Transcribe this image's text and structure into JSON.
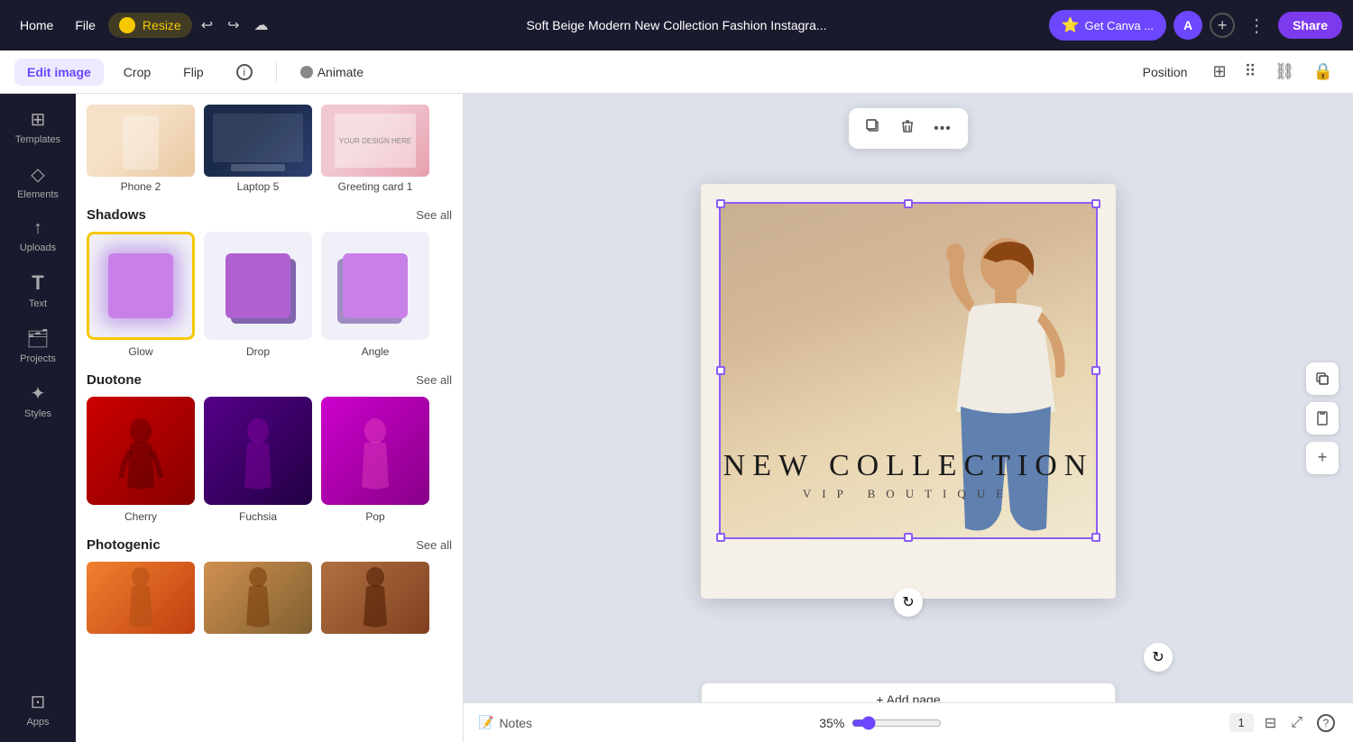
{
  "topbar": {
    "home_label": "Home",
    "file_label": "File",
    "resize_label": "Resize",
    "title": "Soft Beige Modern New Collection Fashion Instagra...",
    "get_canva_label": "Get Canva ...",
    "share_label": "Share",
    "avatar_letter": "A",
    "undo_icon": "↩",
    "redo_icon": "↪",
    "cloud_icon": "☁"
  },
  "secondbar": {
    "edit_image_label": "Edit image",
    "crop_label": "Crop",
    "flip_label": "Flip",
    "info_icon": "ⓘ",
    "animate_icon": "●",
    "animate_label": "Animate",
    "position_label": "Position",
    "grid_icon": "⊞",
    "dots_icon": "⋯",
    "link_icon": "⛓",
    "lock_icon": "🔒"
  },
  "sidebar": {
    "items": [
      {
        "label": "Templates",
        "icon": "⊞"
      },
      {
        "label": "Elements",
        "icon": "◇"
      },
      {
        "label": "Uploads",
        "icon": "↑"
      },
      {
        "label": "Text",
        "icon": "T"
      },
      {
        "label": "Projects",
        "icon": "🗂"
      },
      {
        "label": "Styles",
        "icon": "✦"
      },
      {
        "label": "Apps",
        "icon": "⊡"
      }
    ]
  },
  "left_panel": {
    "thumbnails": [
      {
        "label": "Phone 2"
      },
      {
        "label": "Laptop 5"
      },
      {
        "label": "Greeting card 1"
      }
    ],
    "shadows": {
      "title": "Shadows",
      "see_all": "See all",
      "items": [
        {
          "label": "Glow",
          "selected": true
        },
        {
          "label": "Drop",
          "selected": false
        },
        {
          "label": "Angle",
          "selected": false
        }
      ]
    },
    "duotone": {
      "title": "Duotone",
      "see_all": "See all",
      "items": [
        {
          "label": "Cherry"
        },
        {
          "label": "Fuchsia"
        },
        {
          "label": "Pop"
        }
      ]
    },
    "photogenic": {
      "title": "Photogenic",
      "see_all": "See all"
    }
  },
  "canvas": {
    "new_collection": "NEW COLLECTION",
    "vip_boutique": "VIP  BOUTIQUE",
    "add_page": "+ Add page",
    "refresh_tooltip": "Refresh"
  },
  "float_toolbar": {
    "copy_icon": "⊞",
    "delete_icon": "🗑",
    "more_icon": "•••"
  },
  "bottom_bar": {
    "notes_label": "Notes",
    "zoom_pct": "35%",
    "page_label": "1",
    "show_pages_icon": "⊟",
    "fullscreen_icon": "⤢",
    "help_icon": "?"
  }
}
